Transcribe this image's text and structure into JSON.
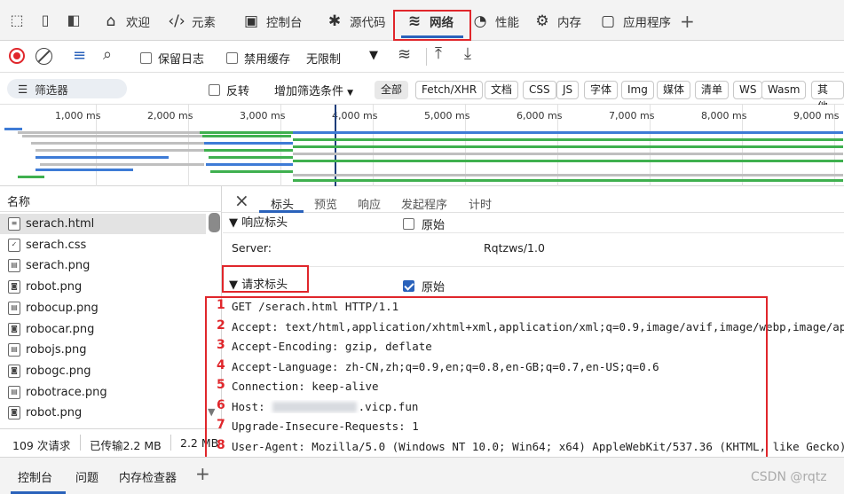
{
  "tabs": [
    {
      "label": "欢迎",
      "icon": "home-icon"
    },
    {
      "label": "元素",
      "icon": "code-icon"
    },
    {
      "label": "控制台",
      "icon": "console-icon"
    },
    {
      "label": "源代码",
      "icon": "bug-icon"
    },
    {
      "label": "网络",
      "icon": "wifi-icon",
      "active": true
    },
    {
      "label": "性能",
      "icon": "gauge-icon"
    },
    {
      "label": "内存",
      "icon": "chip-icon"
    },
    {
      "label": "应用程序",
      "icon": "app-icon"
    }
  ],
  "add_tab": "+",
  "toolbar": {
    "preserve_log": "保留日志",
    "disable_cache": "禁用缓存",
    "throttle": "无限制"
  },
  "filterbar": {
    "placeholder": "筛选器",
    "invert": "反转",
    "more_filters": "增加筛选条件",
    "types": [
      "全部",
      "Fetch/XHR",
      "文档",
      "CSS",
      "JS",
      "字体",
      "Img",
      "媒体",
      "清单",
      "WS",
      "Wasm",
      "其他"
    ]
  },
  "timeline": {
    "ticks": [
      "1,000 ms",
      "2,000 ms",
      "3,000 ms",
      "4,000 ms",
      "5,000 ms",
      "6,000 ms",
      "7,000 ms",
      "8,000 ms",
      "9,000 ms"
    ]
  },
  "files": {
    "header": "名称",
    "items": [
      "serach.html",
      "serach.css",
      "serach.png",
      "robot.png",
      "robocup.png",
      "robocar.png",
      "robojs.png",
      "robogc.png",
      "robotrace.png",
      "robot.png"
    ]
  },
  "status": {
    "requests": "109 次请求",
    "transferred": "已传输2.2 MB",
    "size": "2.2 MB"
  },
  "detail": {
    "tabs": [
      "标头",
      "预览",
      "响应",
      "发起程序",
      "计时"
    ],
    "response_section": "▼ 响应标头",
    "raw": "原始",
    "server_key": "Server:",
    "server_val": "Rqtzws/1.0",
    "request_section": "▼ 请求标头",
    "lines": [
      {
        "n": "1",
        "text": "GET /serach.html HTTP/1.1"
      },
      {
        "n": "2",
        "text": "Accept: text/html,application/xhtml+xml,application/xml;q=0.9,image/avif,image/webp,image/apng"
      },
      {
        "n": "3",
        "text": "Accept-Encoding: gzip, deflate"
      },
      {
        "n": "4",
        "text": "Accept-Language: zh-CN,zh;q=0.9,en;q=0.8,en-GB;q=0.7,en-US;q=0.6"
      },
      {
        "n": "5",
        "text": "Connection: keep-alive"
      },
      {
        "n": "6",
        "text": "Host:",
        "suffix": ".vicp.fun"
      },
      {
        "n": "7",
        "text": "Upgrade-Insecure-Requests: 1"
      },
      {
        "n": "8",
        "text": "User-Agent: Mozilla/5.0 (Windows NT 10.0; Win64; x64) AppleWebKit/537.36 (KHTML, like Gecko)"
      }
    ]
  },
  "drawer": {
    "tabs": [
      "控制台",
      "问题",
      "内存检查器"
    ],
    "add": "+"
  },
  "watermark": "CSDN @rqtz"
}
